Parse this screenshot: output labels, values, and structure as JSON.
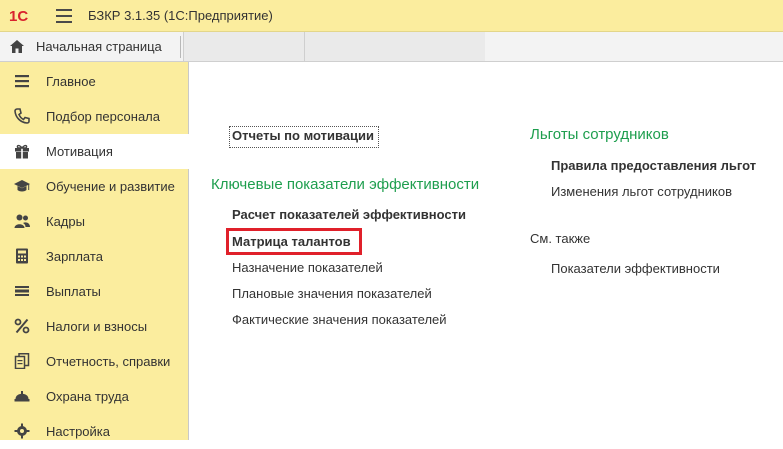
{
  "app": {
    "logo_text": "1С",
    "title": "БЗКР 3.1.35  (1С:Предприятие)"
  },
  "tabs": {
    "home_label": "Начальная страница"
  },
  "sidebar": {
    "items": [
      {
        "label": "Главное",
        "icon": "list-icon",
        "active": false
      },
      {
        "label": "Подбор персонала",
        "icon": "phone-icon",
        "active": false
      },
      {
        "label": "Мотивация",
        "icon": "gift-icon",
        "active": true
      },
      {
        "label": "Обучение и развитие",
        "icon": "graduation-cap-icon",
        "active": false
      },
      {
        "label": "Кадры",
        "icon": "people-icon",
        "active": false
      },
      {
        "label": "Зарплата",
        "icon": "calculator-icon",
        "active": false
      },
      {
        "label": "Выплаты",
        "icon": "wallet-icon",
        "active": false
      },
      {
        "label": "Налоги и взносы",
        "icon": "percent-icon",
        "active": false
      },
      {
        "label": "Отчетность, справки",
        "icon": "documents-icon",
        "active": false
      },
      {
        "label": "Охрана труда",
        "icon": "helmet-icon",
        "active": false
      },
      {
        "label": "Настройка",
        "icon": "gear-icon",
        "active": false
      }
    ]
  },
  "main": {
    "motivation_reports": "Отчеты по мотивации",
    "kpi_section": {
      "title": "Ключевые показатели эффективности",
      "links": [
        "Расчет показателей эффективности",
        "Матрица талантов",
        "Назначение показателей",
        "Плановые значения показателей",
        "Фактические значения показателей"
      ]
    },
    "benefits_section": {
      "title": "Льготы сотрудников",
      "links": [
        "Правила предоставления льгот",
        "Изменения льгот сотрудников"
      ]
    },
    "see_also": {
      "title": "См. также",
      "links": [
        "Показатели эффективности"
      ]
    }
  },
  "colors": {
    "panel_yellow": "#fbed9e",
    "section_green": "#1e9e4e",
    "highlight_red": "#e0202a",
    "logo_red": "#d9232d"
  }
}
